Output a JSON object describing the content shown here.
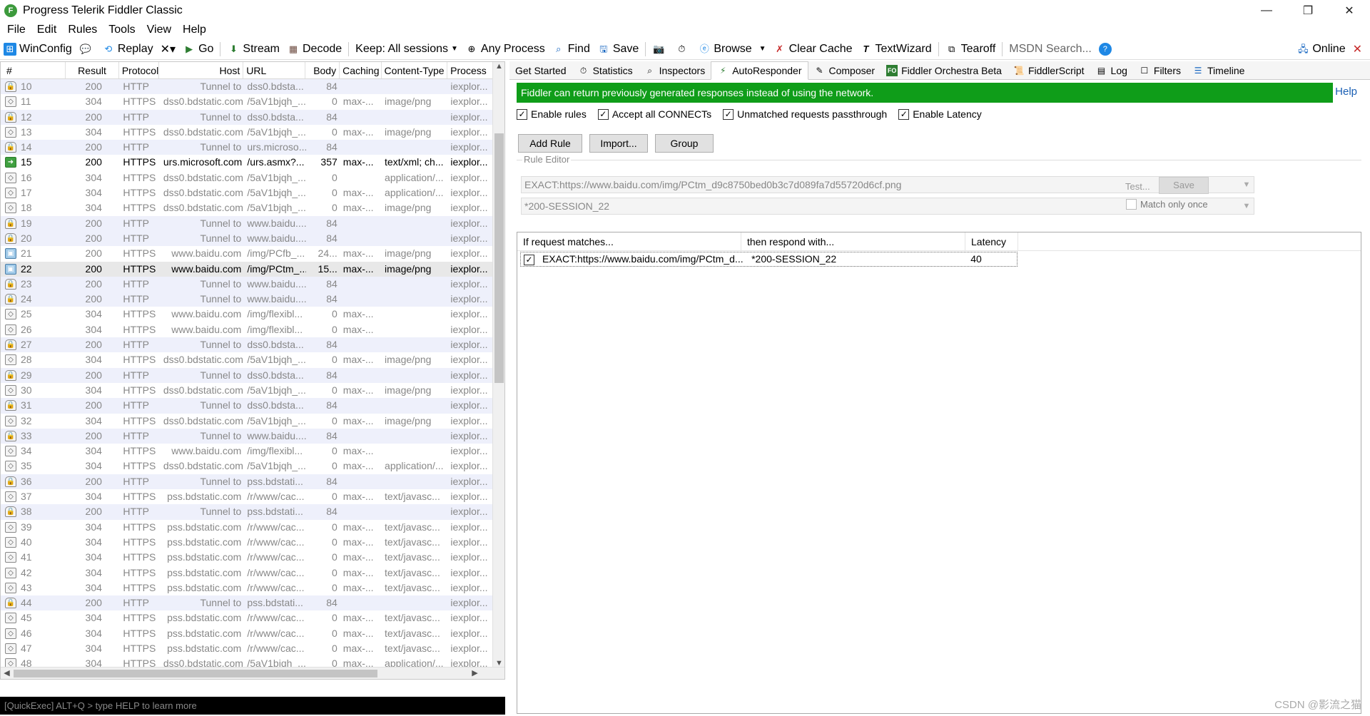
{
  "window": {
    "title": "Progress Telerik Fiddler Classic",
    "app_icon": "fiddler-icon",
    "controls": [
      "—",
      "❐",
      "✕"
    ]
  },
  "menu": [
    "File",
    "Edit",
    "Rules",
    "Tools",
    "View",
    "Help"
  ],
  "toolbar": {
    "winconfig": "WinConfig",
    "replay": "Replay",
    "remove": "✕▾",
    "go": "Go",
    "stream": "Stream",
    "decode": "Decode",
    "keep": "Keep: All sessions",
    "any_process": "Any Process",
    "find": "Find",
    "save": "Save",
    "browse": "Browse",
    "clear_cache": "Clear Cache",
    "textwizard": "TextWizard",
    "tearoff": "Tearoff",
    "msdn_search": "MSDN Search...",
    "online": "Online"
  },
  "sessions": {
    "columns": [
      "#",
      "Result",
      "Protocol",
      "Host",
      "URL",
      "Body",
      "Caching",
      "Content-Type",
      "Process"
    ],
    "rows": [
      {
        "num": "10",
        "result": "200",
        "proto": "HTTP",
        "host": "Tunnel to",
        "url": "dss0.bdsta...",
        "body": "84",
        "cache": "",
        "ctype": "",
        "proc": "iexplor...",
        "kind": "tunnel",
        "icon": "lock"
      },
      {
        "num": "11",
        "result": "304",
        "proto": "HTTPS",
        "host": "dss0.bdstatic.com",
        "url": "/5aV1bjqh_...",
        "body": "0",
        "cache": "max-...",
        "ctype": "image/png",
        "proc": "iexplor...",
        "kind": "normal",
        "icon": "diamond"
      },
      {
        "num": "12",
        "result": "200",
        "proto": "HTTP",
        "host": "Tunnel to",
        "url": "dss0.bdsta...",
        "body": "84",
        "cache": "",
        "ctype": "",
        "proc": "iexplor...",
        "kind": "tunnel",
        "icon": "lock"
      },
      {
        "num": "13",
        "result": "304",
        "proto": "HTTPS",
        "host": "dss0.bdstatic.com",
        "url": "/5aV1bjqh_...",
        "body": "0",
        "cache": "max-...",
        "ctype": "image/png",
        "proc": "iexplor...",
        "kind": "normal",
        "icon": "diamond"
      },
      {
        "num": "14",
        "result": "200",
        "proto": "HTTP",
        "host": "Tunnel to",
        "url": "urs.microso...",
        "body": "84",
        "cache": "",
        "ctype": "",
        "proc": "iexplor...",
        "kind": "tunnel",
        "icon": "lock"
      },
      {
        "num": "15",
        "result": "200",
        "proto": "HTTPS",
        "host": "urs.microsoft.com",
        "url": "/urs.asmx?...",
        "body": "357",
        "cache": "max-...",
        "ctype": "text/xml; ch...",
        "proc": "iexplor...",
        "kind": "dark",
        "icon": "green"
      },
      {
        "num": "16",
        "result": "304",
        "proto": "HTTPS",
        "host": "dss0.bdstatic.com",
        "url": "/5aV1bjqh_...",
        "body": "0",
        "cache": "",
        "ctype": "application/...",
        "proc": "iexplor...",
        "kind": "normal",
        "icon": "diamond"
      },
      {
        "num": "17",
        "result": "304",
        "proto": "HTTPS",
        "host": "dss0.bdstatic.com",
        "url": "/5aV1bjqh_...",
        "body": "0",
        "cache": "max-...",
        "ctype": "application/...",
        "proc": "iexplor...",
        "kind": "normal",
        "icon": "diamond"
      },
      {
        "num": "18",
        "result": "304",
        "proto": "HTTPS",
        "host": "dss0.bdstatic.com",
        "url": "/5aV1bjqh_...",
        "body": "0",
        "cache": "max-...",
        "ctype": "image/png",
        "proc": "iexplor...",
        "kind": "normal",
        "icon": "diamond"
      },
      {
        "num": "19",
        "result": "200",
        "proto": "HTTP",
        "host": "Tunnel to",
        "url": "www.baidu....",
        "body": "84",
        "cache": "",
        "ctype": "",
        "proc": "iexplor...",
        "kind": "tunnel",
        "icon": "lock"
      },
      {
        "num": "20",
        "result": "200",
        "proto": "HTTP",
        "host": "Tunnel to",
        "url": "www.baidu....",
        "body": "84",
        "cache": "",
        "ctype": "",
        "proc": "iexplor...",
        "kind": "tunnel",
        "icon": "lock"
      },
      {
        "num": "21",
        "result": "200",
        "proto": "HTTPS",
        "host": "www.baidu.com",
        "url": "/img/PCfb_...",
        "body": "24...",
        "cache": "max-...",
        "ctype": "image/png",
        "proc": "iexplor...",
        "kind": "normal",
        "icon": "img"
      },
      {
        "num": "22",
        "result": "200",
        "proto": "HTTPS",
        "host": "www.baidu.com",
        "url": "/img/PCtm_...",
        "body": "15...",
        "cache": "max-...",
        "ctype": "image/png",
        "proc": "iexplor...",
        "kind": "selected",
        "icon": "img"
      },
      {
        "num": "23",
        "result": "200",
        "proto": "HTTP",
        "host": "Tunnel to",
        "url": "www.baidu....",
        "body": "84",
        "cache": "",
        "ctype": "",
        "proc": "iexplor...",
        "kind": "tunnel",
        "icon": "lock"
      },
      {
        "num": "24",
        "result": "200",
        "proto": "HTTP",
        "host": "Tunnel to",
        "url": "www.baidu....",
        "body": "84",
        "cache": "",
        "ctype": "",
        "proc": "iexplor...",
        "kind": "tunnel",
        "icon": "lock"
      },
      {
        "num": "25",
        "result": "304",
        "proto": "HTTPS",
        "host": "www.baidu.com",
        "url": "/img/flexibl...",
        "body": "0",
        "cache": "max-...",
        "ctype": "",
        "proc": "iexplor...",
        "kind": "normal",
        "icon": "diamond"
      },
      {
        "num": "26",
        "result": "304",
        "proto": "HTTPS",
        "host": "www.baidu.com",
        "url": "/img/flexibl...",
        "body": "0",
        "cache": "max-...",
        "ctype": "",
        "proc": "iexplor...",
        "kind": "normal",
        "icon": "diamond"
      },
      {
        "num": "27",
        "result": "200",
        "proto": "HTTP",
        "host": "Tunnel to",
        "url": "dss0.bdsta...",
        "body": "84",
        "cache": "",
        "ctype": "",
        "proc": "iexplor...",
        "kind": "tunnel",
        "icon": "lock"
      },
      {
        "num": "28",
        "result": "304",
        "proto": "HTTPS",
        "host": "dss0.bdstatic.com",
        "url": "/5aV1bjqh_...",
        "body": "0",
        "cache": "max-...",
        "ctype": "image/png",
        "proc": "iexplor...",
        "kind": "normal",
        "icon": "diamond"
      },
      {
        "num": "29",
        "result": "200",
        "proto": "HTTP",
        "host": "Tunnel to",
        "url": "dss0.bdsta...",
        "body": "84",
        "cache": "",
        "ctype": "",
        "proc": "iexplor...",
        "kind": "tunnel",
        "icon": "lock"
      },
      {
        "num": "30",
        "result": "304",
        "proto": "HTTPS",
        "host": "dss0.bdstatic.com",
        "url": "/5aV1bjqh_...",
        "body": "0",
        "cache": "max-...",
        "ctype": "image/png",
        "proc": "iexplor...",
        "kind": "normal",
        "icon": "diamond"
      },
      {
        "num": "31",
        "result": "200",
        "proto": "HTTP",
        "host": "Tunnel to",
        "url": "dss0.bdsta...",
        "body": "84",
        "cache": "",
        "ctype": "",
        "proc": "iexplor...",
        "kind": "tunnel",
        "icon": "lock"
      },
      {
        "num": "32",
        "result": "304",
        "proto": "HTTPS",
        "host": "dss0.bdstatic.com",
        "url": "/5aV1bjqh_...",
        "body": "0",
        "cache": "max-...",
        "ctype": "image/png",
        "proc": "iexplor...",
        "kind": "normal",
        "icon": "diamond"
      },
      {
        "num": "33",
        "result": "200",
        "proto": "HTTP",
        "host": "Tunnel to",
        "url": "www.baidu....",
        "body": "84",
        "cache": "",
        "ctype": "",
        "proc": "iexplor...",
        "kind": "tunnel",
        "icon": "lock"
      },
      {
        "num": "34",
        "result": "304",
        "proto": "HTTPS",
        "host": "www.baidu.com",
        "url": "/img/flexibl...",
        "body": "0",
        "cache": "max-...",
        "ctype": "",
        "proc": "iexplor...",
        "kind": "normal",
        "icon": "diamond"
      },
      {
        "num": "35",
        "result": "304",
        "proto": "HTTPS",
        "host": "dss0.bdstatic.com",
        "url": "/5aV1bjqh_...",
        "body": "0",
        "cache": "max-...",
        "ctype": "application/...",
        "proc": "iexplor...",
        "kind": "normal",
        "icon": "diamond"
      },
      {
        "num": "36",
        "result": "200",
        "proto": "HTTP",
        "host": "Tunnel to",
        "url": "pss.bdstati...",
        "body": "84",
        "cache": "",
        "ctype": "",
        "proc": "iexplor...",
        "kind": "tunnel",
        "icon": "lock"
      },
      {
        "num": "37",
        "result": "304",
        "proto": "HTTPS",
        "host": "pss.bdstatic.com",
        "url": "/r/www/cac...",
        "body": "0",
        "cache": "max-...",
        "ctype": "text/javasc...",
        "proc": "iexplor...",
        "kind": "normal",
        "icon": "diamond"
      },
      {
        "num": "38",
        "result": "200",
        "proto": "HTTP",
        "host": "Tunnel to",
        "url": "pss.bdstati...",
        "body": "84",
        "cache": "",
        "ctype": "",
        "proc": "iexplor...",
        "kind": "tunnel",
        "icon": "lock"
      },
      {
        "num": "39",
        "result": "304",
        "proto": "HTTPS",
        "host": "pss.bdstatic.com",
        "url": "/r/www/cac...",
        "body": "0",
        "cache": "max-...",
        "ctype": "text/javasc...",
        "proc": "iexplor...",
        "kind": "normal",
        "icon": "diamond"
      },
      {
        "num": "40",
        "result": "304",
        "proto": "HTTPS",
        "host": "pss.bdstatic.com",
        "url": "/r/www/cac...",
        "body": "0",
        "cache": "max-...",
        "ctype": "text/javasc...",
        "proc": "iexplor...",
        "kind": "normal",
        "icon": "diamond"
      },
      {
        "num": "41",
        "result": "304",
        "proto": "HTTPS",
        "host": "pss.bdstatic.com",
        "url": "/r/www/cac...",
        "body": "0",
        "cache": "max-...",
        "ctype": "text/javasc...",
        "proc": "iexplor...",
        "kind": "normal",
        "icon": "diamond"
      },
      {
        "num": "42",
        "result": "304",
        "proto": "HTTPS",
        "host": "pss.bdstatic.com",
        "url": "/r/www/cac...",
        "body": "0",
        "cache": "max-...",
        "ctype": "text/javasc...",
        "proc": "iexplor...",
        "kind": "normal",
        "icon": "diamond"
      },
      {
        "num": "43",
        "result": "304",
        "proto": "HTTPS",
        "host": "pss.bdstatic.com",
        "url": "/r/www/cac...",
        "body": "0",
        "cache": "max-...",
        "ctype": "text/javasc...",
        "proc": "iexplor...",
        "kind": "normal",
        "icon": "diamond"
      },
      {
        "num": "44",
        "result": "200",
        "proto": "HTTP",
        "host": "Tunnel to",
        "url": "pss.bdstati...",
        "body": "84",
        "cache": "",
        "ctype": "",
        "proc": "iexplor...",
        "kind": "tunnel",
        "icon": "lock"
      },
      {
        "num": "45",
        "result": "304",
        "proto": "HTTPS",
        "host": "pss.bdstatic.com",
        "url": "/r/www/cac...",
        "body": "0",
        "cache": "max-...",
        "ctype": "text/javasc...",
        "proc": "iexplor...",
        "kind": "normal",
        "icon": "diamond"
      },
      {
        "num": "46",
        "result": "304",
        "proto": "HTTPS",
        "host": "pss.bdstatic.com",
        "url": "/r/www/cac...",
        "body": "0",
        "cache": "max-...",
        "ctype": "text/javasc...",
        "proc": "iexplor...",
        "kind": "normal",
        "icon": "diamond"
      },
      {
        "num": "47",
        "result": "304",
        "proto": "HTTPS",
        "host": "pss.bdstatic.com",
        "url": "/r/www/cac...",
        "body": "0",
        "cache": "max-...",
        "ctype": "text/javasc...",
        "proc": "iexplor...",
        "kind": "normal",
        "icon": "diamond"
      },
      {
        "num": "48",
        "result": "304",
        "proto": "HTTPS",
        "host": "dss0.bdstatic.com",
        "url": "/5aV1bjqh_...",
        "body": "0",
        "cache": "max-...",
        "ctype": "application/...",
        "proc": "iexplor...",
        "kind": "normal",
        "icon": "diamond"
      }
    ]
  },
  "quickexec": "[QuickExec] ALT+Q > type HELP to learn more",
  "tabs": [
    "Get Started",
    "Statistics",
    "Inspectors",
    "AutoResponder",
    "Composer",
    "Fiddler Orchestra Beta",
    "FiddlerScript",
    "Log",
    "Filters",
    "Timeline"
  ],
  "active_tab": "AutoResponder",
  "autoresponder": {
    "banner": "Fiddler can return previously generated responses instead of using the network.",
    "help": "Help",
    "checks": [
      {
        "label": "Enable rules",
        "checked": true
      },
      {
        "label": "Accept all CONNECTs",
        "checked": true
      },
      {
        "label": "Unmatched requests passthrough",
        "checked": true
      },
      {
        "label": "Enable Latency",
        "checked": true
      }
    ],
    "add_rule": "Add Rule",
    "import": "Import...",
    "group": "Group",
    "rule_editor_label": "Rule Editor",
    "match_field": "EXACT:https://www.baidu.com/img/PCtm_d9c8750bed0b3c7d089fa7d55720d6cf.png",
    "action_field": "*200-SESSION_22",
    "test": "Test...",
    "save": "Save",
    "match_only_once": "Match only once",
    "rule_columns": [
      "If request matches...",
      "then respond with...",
      "Latency"
    ],
    "rules": [
      {
        "checked": true,
        "match": "EXACT:https://www.baidu.com/img/PCtm_d...",
        "respond": "*200-SESSION_22",
        "latency": "40"
      }
    ]
  },
  "watermark": "CSDN @影流之猫",
  "colors": {
    "banner": "#0f9d19",
    "tunnel_row": "#eef0fb",
    "selected_row": "#e8e8e8"
  }
}
